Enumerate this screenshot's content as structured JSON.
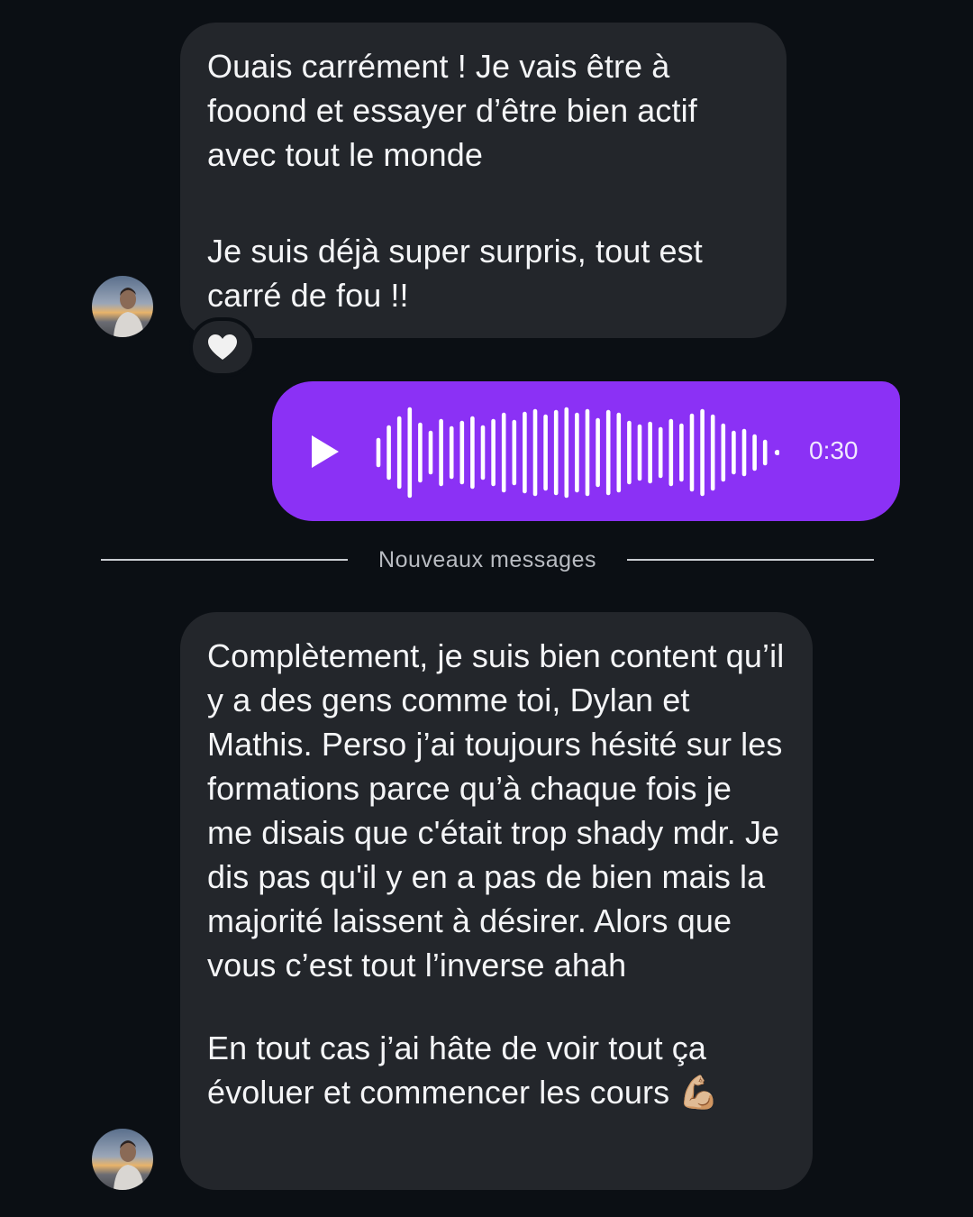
{
  "conversation": {
    "messages": [
      {
        "direction": "incoming",
        "paragraphs": [
          "Ouais carrément ! Je vais être à fooond et essayer d’être bien actif avec tout le monde",
          "Je suis déjà super surpris, tout est carré de fou !!"
        ],
        "reaction": "heart-icon"
      },
      {
        "direction": "outgoing",
        "type": "voice",
        "duration": "0:30",
        "icon": "play-icon",
        "colors": {
          "bubble": "#8b31f5",
          "wave": "#ffffff"
        }
      },
      {
        "direction": "incoming",
        "paragraphs": [
          "Complètement, je suis bien content qu’il y a des gens comme toi, Dylan et Mathis. Perso j’ai toujours hésité sur les formations parce qu’à chaque fois je me disais que c'était trop shady mdr. Je dis pas qu'il y en a pas de bien mais la majorité laissent à désirer. Alors que vous c’est tout l’inverse ahah",
          "En tout cas j’ai hâte de voir tout ça évoluer et commencer les cours 💪🏼"
        ]
      }
    ],
    "divider": {
      "label": "Nouveaux messages"
    }
  },
  "theme": {
    "background": "#0b0f14",
    "incoming_bubble": "#23262b",
    "text": "#f4f5f7"
  }
}
